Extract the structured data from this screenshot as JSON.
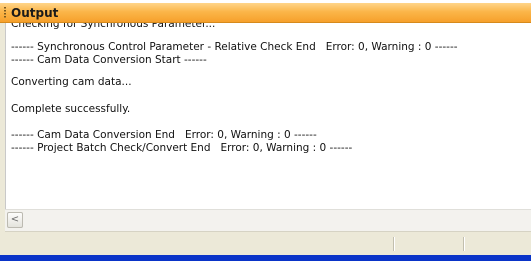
{
  "panel": {
    "title": "Output"
  },
  "output": {
    "lines": [
      "Checking for Synchronous Parameter...",
      "------ Synchronous Control Parameter - Relative Check End   Error: 0, Warning : 0 ------",
      "------ Cam Data Conversion Start ------",
      "Converting cam data...",
      "Complete successfully.",
      "------ Cam Data Conversion End   Error: 0, Warning : 0 ------",
      "------ Project Batch Check/Convert End   Error: 0, Warning : 0 ------"
    ]
  },
  "scrollbar": {
    "left_arrow": "<"
  },
  "colors": {
    "titlebar": "#f6a02b",
    "taskbar": "#0a34c8",
    "statusbar": "#ece9d8"
  }
}
